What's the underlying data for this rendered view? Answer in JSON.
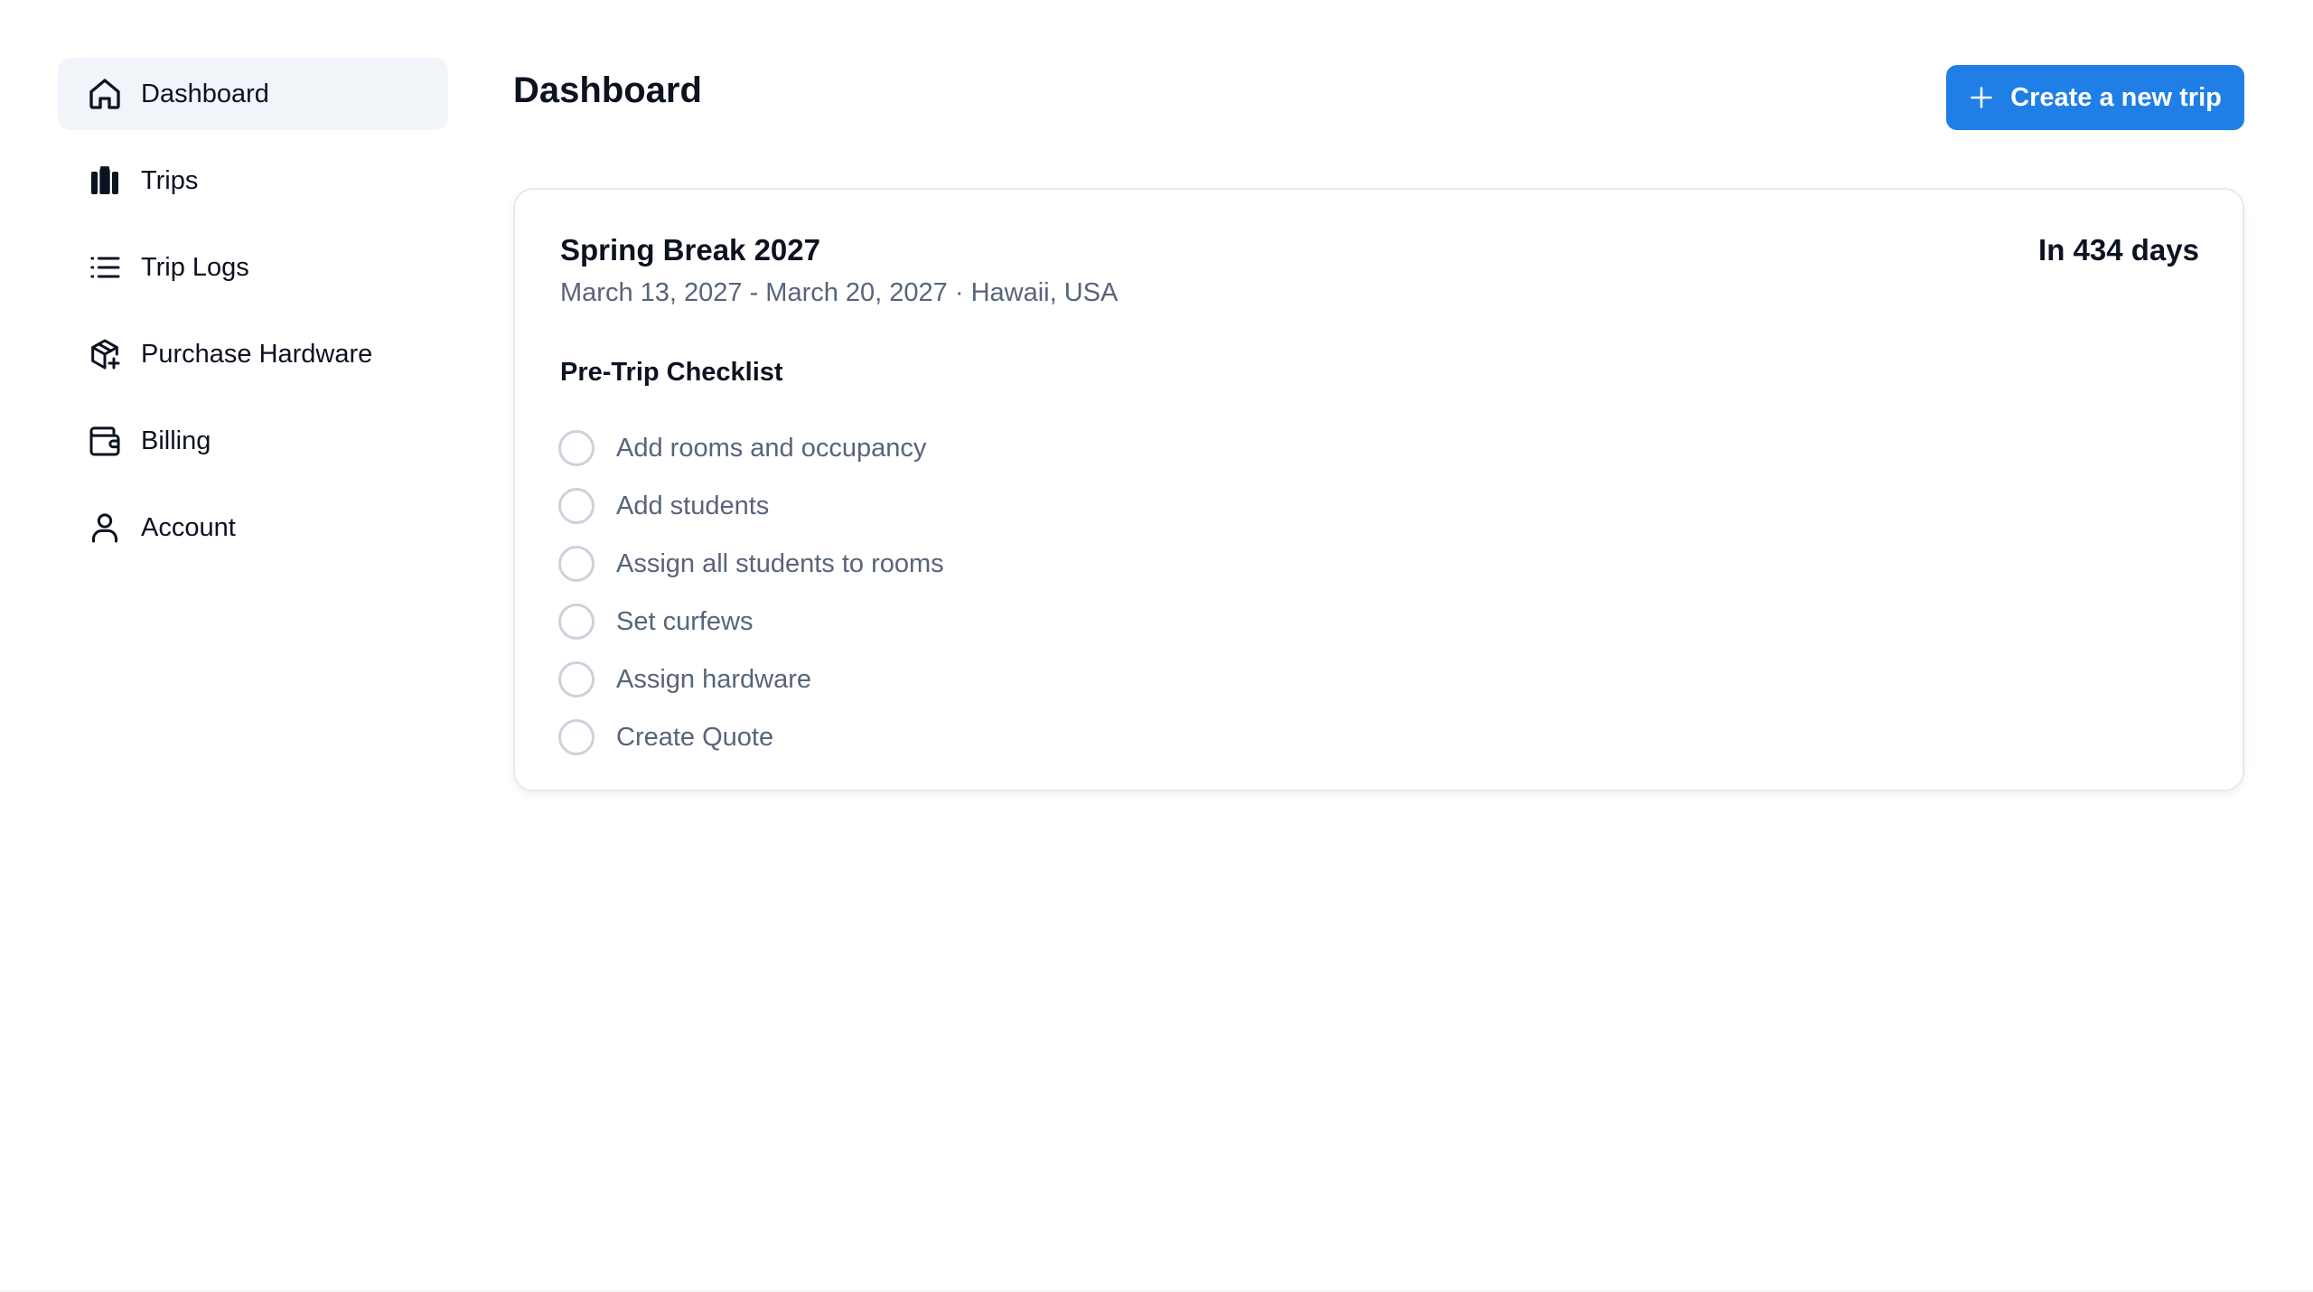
{
  "sidebar": {
    "items": [
      {
        "label": "Dashboard",
        "icon": "home-icon",
        "active": true
      },
      {
        "label": "Trips",
        "icon": "luggage-icon",
        "active": false
      },
      {
        "label": "Trip Logs",
        "icon": "list-icon",
        "active": false
      },
      {
        "label": "Purchase Hardware",
        "icon": "package-plus-icon",
        "active": false
      },
      {
        "label": "Billing",
        "icon": "wallet-icon",
        "active": false
      },
      {
        "label": "Account",
        "icon": "user-icon",
        "active": false
      }
    ]
  },
  "header": {
    "title": "Dashboard",
    "create_button_label": "Create a new trip",
    "create_button_icon": "plus-icon"
  },
  "trip": {
    "title": "Spring Break 2027",
    "countdown": "In 434 days",
    "meta": "March 13, 2027 - March 20, 2027 · Hawaii, USA",
    "checklist_title": "Pre-Trip Checklist",
    "checklist": [
      {
        "label": "Add rooms and occupancy",
        "done": false
      },
      {
        "label": "Add students",
        "done": false
      },
      {
        "label": "Assign all students to rooms",
        "done": false
      },
      {
        "label": "Set curfews",
        "done": false
      },
      {
        "label": "Assign hardware",
        "done": false
      },
      {
        "label": "Create Quote",
        "done": false
      }
    ]
  },
  "colors": {
    "accent": "#1f7fe6",
    "active_nav_bg": "#f1f4f8",
    "muted_text": "#56657a",
    "circle_border": "#cbd2db"
  }
}
